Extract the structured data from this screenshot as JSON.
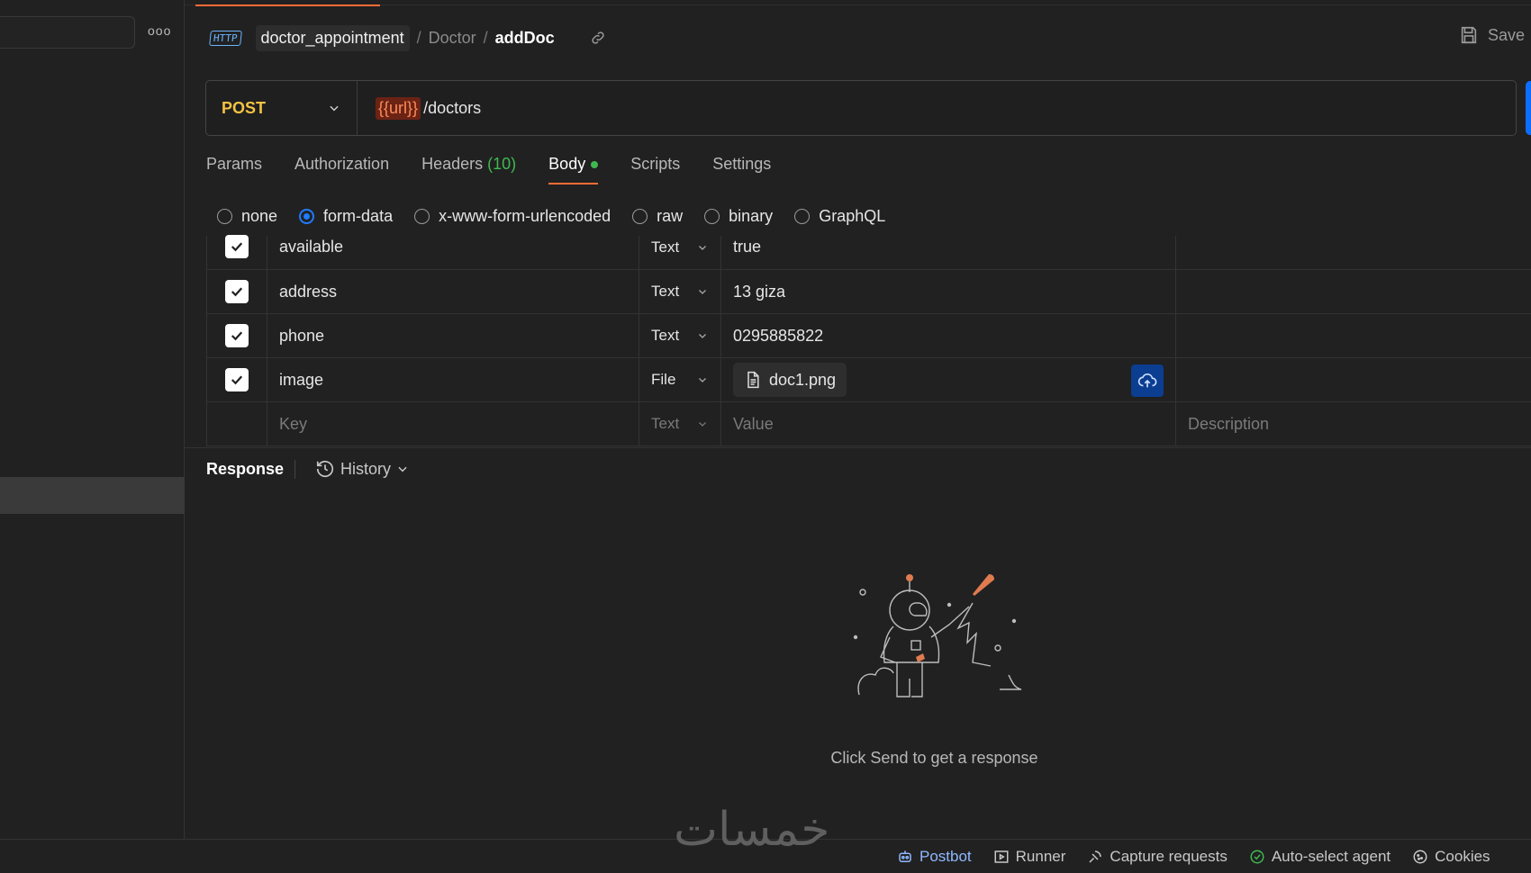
{
  "sidebar": {
    "more_label": "ooo"
  },
  "breadcrumb": {
    "protocol": "HTTP",
    "collection": "doctor_appointment",
    "separator": "/",
    "folder": "Doctor",
    "request": "addDoc",
    "save_label": "Save"
  },
  "request": {
    "method": "POST",
    "url_variable": "{{url}}",
    "url_path": "/doctors"
  },
  "tabs": [
    {
      "label": "Params"
    },
    {
      "label": "Authorization"
    },
    {
      "label": "Headers",
      "count": "(10)"
    },
    {
      "label": "Body",
      "active": true
    },
    {
      "label": "Scripts"
    },
    {
      "label": "Settings"
    }
  ],
  "body_modes": [
    "none",
    "form-data",
    "x-www-form-urlencoded",
    "raw",
    "binary",
    "GraphQL"
  ],
  "body_mode_selected": "form-data",
  "form_rows": [
    {
      "key": "available",
      "type": "Text",
      "value": "true"
    },
    {
      "key": "address",
      "type": "Text",
      "value": "13 giza"
    },
    {
      "key": "phone",
      "type": "Text",
      "value": "0295885822"
    },
    {
      "key": "image",
      "type": "File",
      "value": "doc1.png"
    }
  ],
  "placeholder_row": {
    "key": "Key",
    "type": "Text",
    "value": "Value",
    "description": "Description"
  },
  "response": {
    "title": "Response",
    "history_label": "History",
    "empty_message": "Click Send to get a response"
  },
  "statusbar": {
    "postbot": "Postbot",
    "runner": "Runner",
    "capture": "Capture requests",
    "agent": "Auto-select agent",
    "cookies": "Cookies"
  },
  "watermark": "خمسات",
  "colors": {
    "accent": "#ff6c37",
    "method": "#f5c343",
    "selected_radio": "#1f7bff",
    "status_green": "#3fb950",
    "url_variable": "#ff8c5a"
  }
}
